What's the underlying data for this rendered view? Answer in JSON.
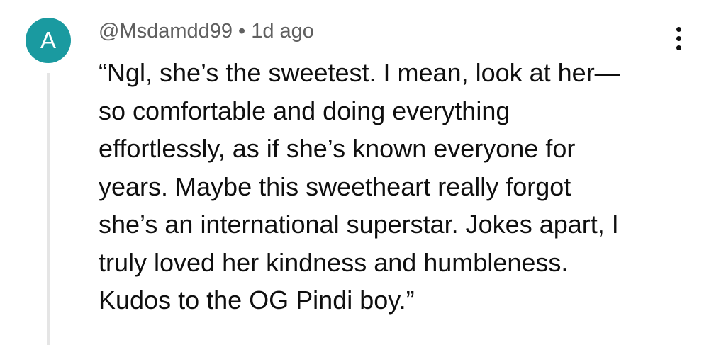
{
  "comment": {
    "avatar_letter": "A",
    "avatar_color": "#1a9aa0",
    "username": "@Msdamdd99",
    "separator": "•",
    "timestamp": "1d ago",
    "menu_icon": "more-vertical-icon",
    "lines": [
      "“Ngl, she’s the sweetest. I mean, look at her—",
      "so comfortable and doing everything",
      "effortlessly, as if she’s known everyone for",
      "years. Maybe this sweetheart really forgot",
      "she’s an international superstar. Jokes apart, I",
      "truly loved her kindness and humbleness.",
      "Kudos to the OG Pindi boy.”"
    ]
  }
}
